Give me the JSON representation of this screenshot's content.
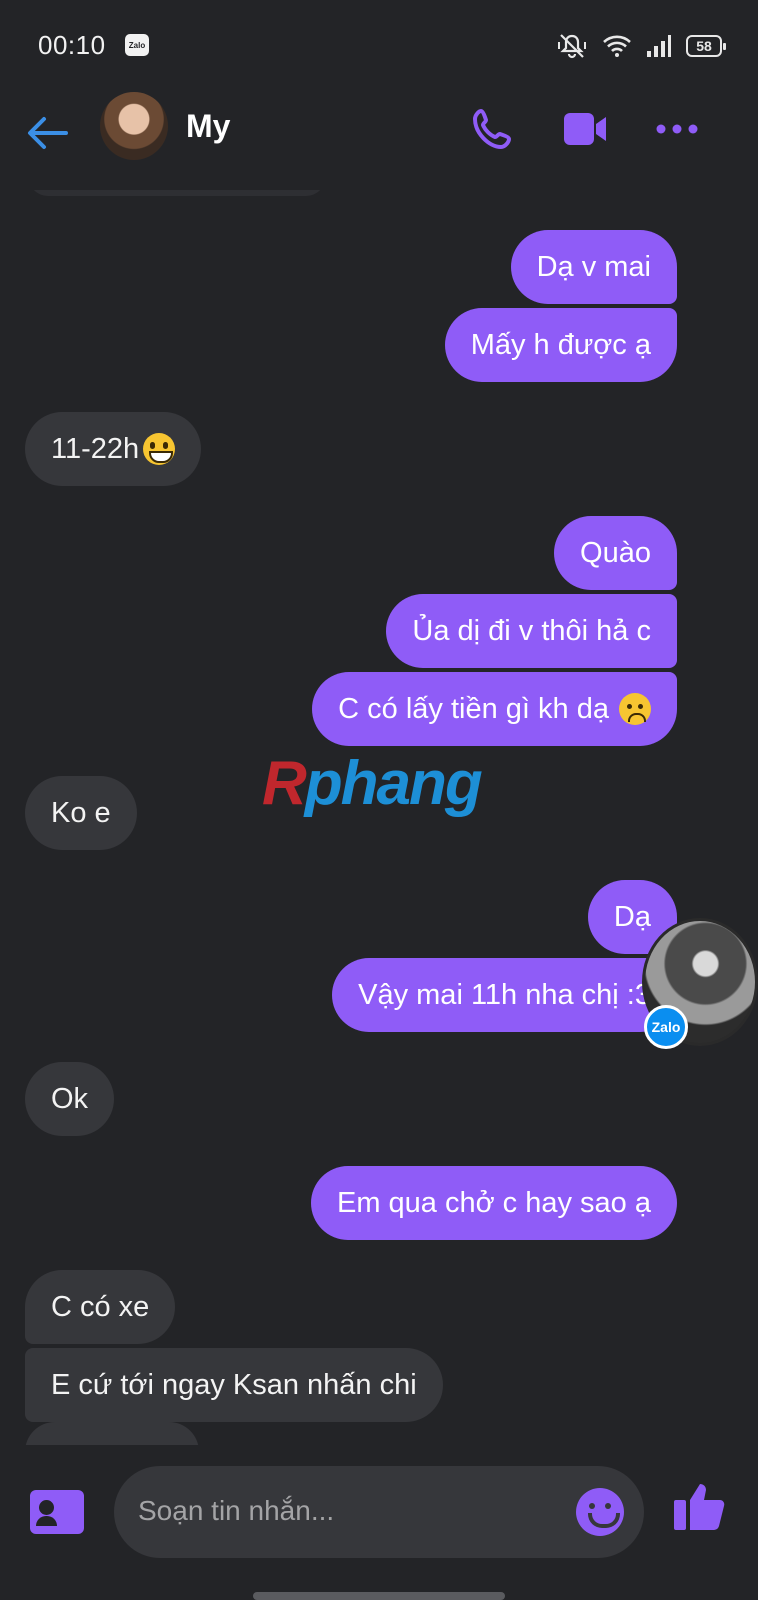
{
  "status_bar": {
    "time": "00:10",
    "app_badge": "Zalo",
    "battery": "58",
    "icons": [
      "bell-muted-icon",
      "wifi-icon",
      "signal-icon",
      "battery-icon"
    ]
  },
  "header": {
    "contact_name": "My",
    "icons": [
      "back-arrow-icon",
      "phone-icon",
      "video-camera-icon",
      "more-dots-icon"
    ]
  },
  "messages": [
    {
      "id": "m1",
      "side": "out",
      "text": "Dạ v mai"
    },
    {
      "id": "m2",
      "side": "out",
      "text": "Mấy h được ạ"
    },
    {
      "id": "m3",
      "side": "in",
      "text": "11-22h",
      "emoji": "grinning-face"
    },
    {
      "id": "m4",
      "side": "out",
      "text": "Quào"
    },
    {
      "id": "m5",
      "side": "out",
      "text": "Ủa dị đi v thôi hả c"
    },
    {
      "id": "m6",
      "side": "out",
      "text": "C có lấy tiền gì kh dạ",
      "emoji": "frowning-face"
    },
    {
      "id": "m7",
      "side": "in",
      "text": "Ko e"
    },
    {
      "id": "m8",
      "side": "out",
      "text": "Dạ"
    },
    {
      "id": "m9",
      "side": "out",
      "text": "Vậy mai 11h nha chị :3"
    },
    {
      "id": "m10",
      "side": "in",
      "text": "Ok"
    },
    {
      "id": "m11",
      "side": "out",
      "text": "Em qua chở c hay sao ạ"
    },
    {
      "id": "m12",
      "side": "in",
      "text": "C có xe"
    },
    {
      "id": "m13",
      "side": "in",
      "text": "E cứ tới ngay Ksan nhấn chi"
    }
  ],
  "watermark": {
    "first": "R",
    "rest": "phang"
  },
  "seen_badge": "Zalo",
  "composer": {
    "placeholder": "Soạn tin nhắn...",
    "icons": [
      "contact-card-icon",
      "emoji-smile-icon",
      "thumbs-up-icon"
    ]
  },
  "colors": {
    "accent": "#8f5cf7",
    "background": "#232427",
    "incoming_bubble": "#36373b",
    "back_arrow": "#3b8fe6"
  }
}
